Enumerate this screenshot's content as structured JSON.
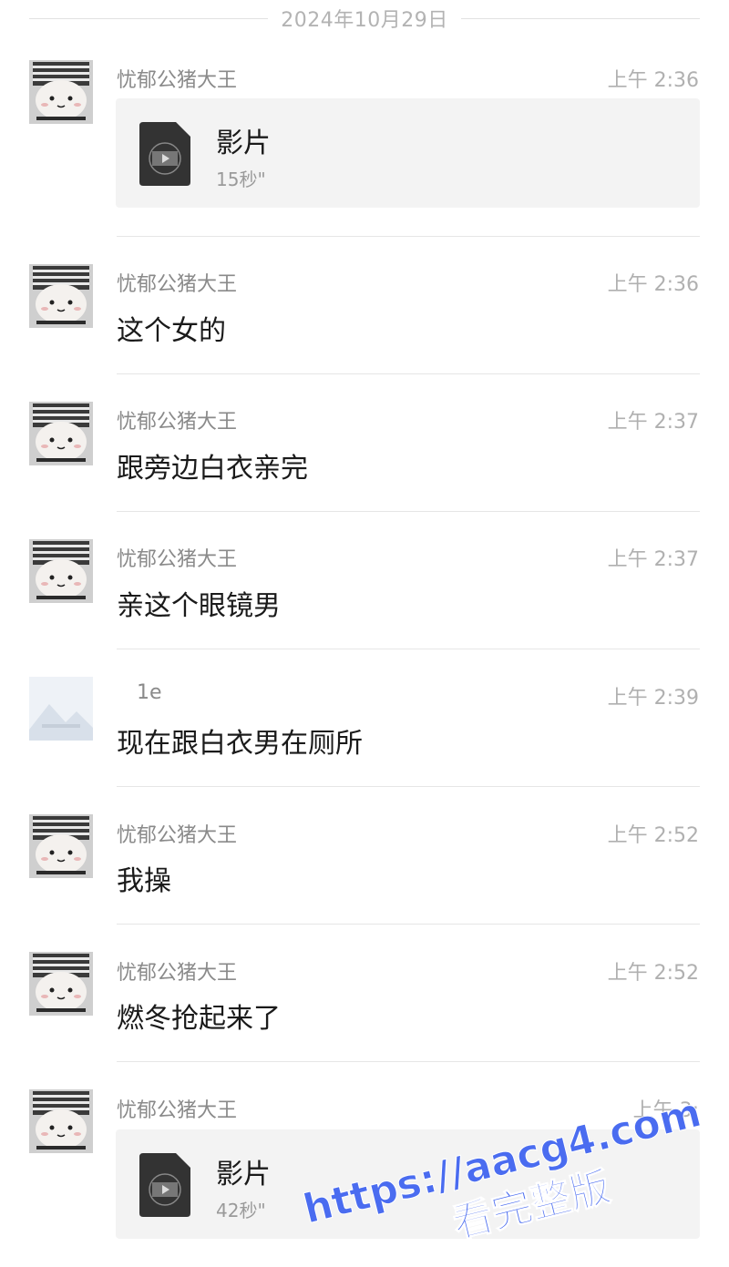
{
  "date_separator": "2024年10月29日",
  "messages": [
    {
      "sender": "忧郁公猪大王",
      "time": "上午 2:36",
      "type": "video",
      "video_title": "影片",
      "video_duration": "15秒\""
    },
    {
      "sender": "忧郁公猪大王",
      "time": "上午 2:36",
      "type": "text",
      "text": "这个女的"
    },
    {
      "sender": "忧郁公猪大王",
      "time": "上午 2:37",
      "type": "text",
      "text": "跟旁边白衣亲完"
    },
    {
      "sender": "忧郁公猪大王",
      "time": "上午 2:37",
      "type": "text",
      "text": "亲这个眼镜男"
    },
    {
      "sender": "1e",
      "time": "上午 2:39",
      "type": "text",
      "text": "现在跟白衣男在厕所"
    },
    {
      "sender": "忧郁公猪大王",
      "time": "上午 2:52",
      "type": "text",
      "text": "我操"
    },
    {
      "sender": "忧郁公猪大王",
      "time": "上午 2:52",
      "type": "text",
      "text": "燃冬抢起来了"
    },
    {
      "sender": "忧郁公猪大王",
      "time": "上午 3:",
      "type": "video",
      "video_title": "影片",
      "video_duration": "42秒\""
    }
  ],
  "watermark": {
    "line1": "https://aacg4.com",
    "line2": "看完整版",
    "color": "#4a6cf0"
  },
  "icons": {
    "avatar_pig": "hamster-avatar",
    "avatar_placeholder": "image-placeholder-icon",
    "video_file": "video-file-icon"
  }
}
